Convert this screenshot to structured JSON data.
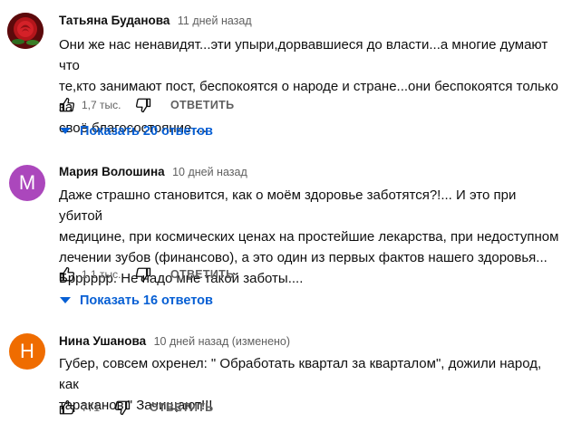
{
  "comments": [
    {
      "author": "Татьяна Буданова",
      "time": "11 дней назад",
      "lines": [
        "Они же нас ненавидят...эти упыри,дорвавшиеся до власти...а многие думают что",
        "те,кто занимают пост, беспокоятся о народе и стране...они беспокоятся только за",
        "своё благосостояние...."
      ],
      "likes": "1,7 тыс.",
      "reply_label": "ОТВЕТИТЬ",
      "show_replies": "Показать 20 ответов",
      "avatar_icon": "red-rose-icon"
    },
    {
      "author": "Мария Волошина",
      "time": "10 дней назад",
      "avatar_letter": "М",
      "avatar_color": "#ab47bc",
      "lines": [
        "Даже страшно становится, как  о моём здоровье заботятся?!... И это при убитой",
        "медицине, при космических ценах на простейшие лекарства, при недоступном",
        "лечении   зубов (финансово), а это один из первых фактов нашего здоровья...",
        "Брррррр. Не надо мне такой заботы...."
      ],
      "likes": "1,1 тыс.",
      "reply_label": "ОТВЕТИТЬ",
      "show_replies": "Показать 16 ответов"
    },
    {
      "author": "Нина Ушанова",
      "time": "10 дней назад (изменено)",
      "avatar_letter": "Н",
      "avatar_color": "#ef6c00",
      "lines": [
        "Губер, совсем охренел: \" Обработать квартал за кварталом\", дожили народ, как",
        "тараканов  \" Зачищают!!!"
      ],
      "likes": "771",
      "reply_label": "ОТВЕТИТЬ"
    }
  ]
}
